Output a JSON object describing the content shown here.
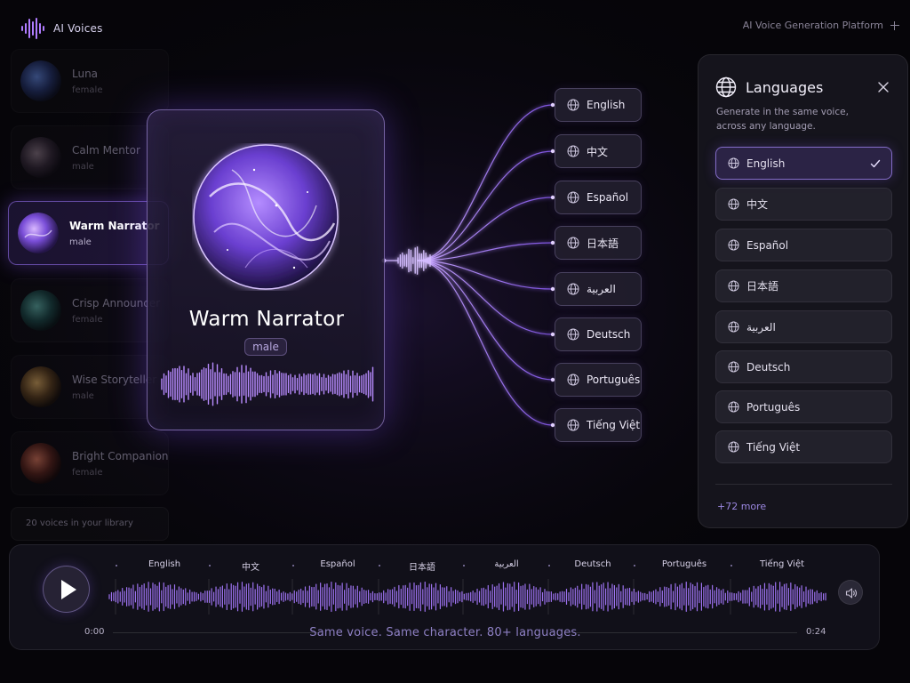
{
  "brand": {
    "name": "AI Voices"
  },
  "header": {
    "platform_title": "AI Voice Generation Platform"
  },
  "library": {
    "voices": [
      {
        "name": "Luna",
        "gender": "female",
        "active": false
      },
      {
        "name": "Calm Mentor",
        "gender": "male",
        "active": false
      },
      {
        "name": "Warm Narrator",
        "gender": "male",
        "active": true
      },
      {
        "name": "Crisp Announcer",
        "gender": "female",
        "active": false
      },
      {
        "name": "Wise Storyteller",
        "gender": "male",
        "active": false
      },
      {
        "name": "Bright Companion",
        "gender": "female",
        "active": false
      }
    ],
    "count_text": "20 voices in your library"
  },
  "card": {
    "name": "Warm Narrator",
    "gender": "male"
  },
  "languages": [
    "English",
    "中文",
    "Español",
    "日本語",
    "العربية",
    "Deutsch",
    "Português",
    "Tiếng Việt"
  ],
  "panel": {
    "title": "Languages",
    "subtitle_line1": "Generate in the same voice,",
    "subtitle_line2": "across any language.",
    "selected": "English",
    "more_text": "+72 more"
  },
  "player": {
    "time_start": "0:00",
    "time_end": "0:24",
    "tagline": "Same voice. Same character. 80+ languages."
  },
  "colors": {
    "accent": "#9b6bff",
    "accent_light": "#c9a8ff",
    "background": "#060509"
  }
}
